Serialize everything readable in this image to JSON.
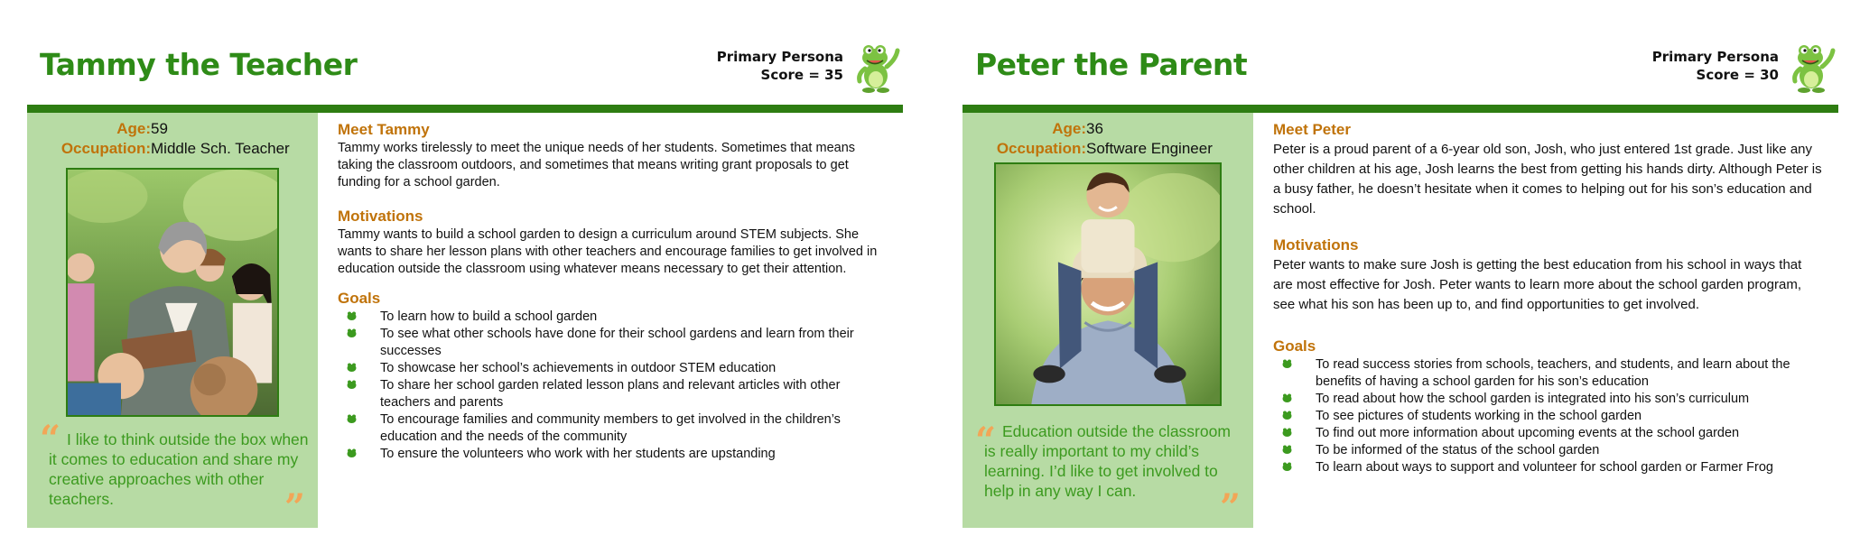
{
  "personas": [
    {
      "title": "Tammy the Teacher",
      "persona_type": "Primary Persona",
      "score": "Score = 35",
      "age_label": "Age:",
      "age": "59",
      "occupation_label": "Occupation:",
      "occupation": "Middle Sch. Teacher",
      "meet_heading": "Meet Tammy",
      "meet_text": "Tammy works tirelessly to meet the unique needs of her students. Sometimes that means taking the classroom outdoors, and sometimes that means writing grant proposals to get funding for a school garden.",
      "motivations_heading": "Motivations",
      "motivations_text": "Tammy wants to build a school garden to design a curriculum around STEM subjects. She wants to share her lesson plans with other teachers and encourage families to get involved in education outside the classroom using whatever means necessary to get their attention.",
      "goals_heading": "Goals",
      "goals": [
        "To learn how to build a school garden",
        "To see what other schools have done for their school gardens and learn from their successes",
        "To showcase her school’s achievements in outdoor STEM education",
        "To share her school garden related lesson plans and relevant articles with other teachers and parents",
        "To encourage families and community members to get involved in the children’s education and the needs of the community",
        "To ensure the volunteers who work with her students are upstanding"
      ],
      "quote": "I like to think outside the box when it comes to education and share my creative approaches with other teachers.",
      "photo_icon": "teacher-with-students-photo"
    },
    {
      "title": "Peter the Parent",
      "persona_type": "Primary Persona",
      "score": "Score = 30",
      "age_label": "Age:",
      "age": "36",
      "occupation_label": "Occupation:",
      "occupation": "Software Engineer",
      "meet_heading": "Meet Peter",
      "meet_text": "Peter is a proud parent of a 6-year old son, Josh, who just entered 1st grade. Just like any other children at his age, Josh learns the best from getting his hands dirty. Although Peter is a busy father, he doesn’t hesitate when it comes to helping out for his son’s education and school.",
      "motivations_heading": "Motivations",
      "motivations_text": "Peter wants to make sure Josh is getting the best education from his school in ways that are most effective for Josh. Peter wants to learn more about the school garden program, see what his son has been up to, and find opportunities to get involved.",
      "goals_heading": "Goals",
      "goals": [
        "To read success stories from schools, teachers, and students, and learn about the benefits of having a school garden for his son’s education",
        "To read about how the school garden is integrated into his son’s curriculum",
        "To see pictures of students working in the school garden",
        "To find out more information about upcoming events at the school garden",
        "To be informed of the status of the school garden",
        "To learn about ways to support and volunteer for school garden or Farmer Frog"
      ],
      "quote": "Education outside the classroom is really important to my child’s learning. I’d like to get involved to help in any way I can.",
      "photo_icon": "father-with-son-photo"
    }
  ],
  "colors": {
    "title_green": "#2e8b17",
    "rule_green": "#2e7d12",
    "sidebar_bg": "#b7dba4",
    "heading_orange": "#c0730a",
    "quote_green": "#3c9a1f",
    "quote_mark": "#f2a657"
  },
  "icons": {
    "frog": "frog-mascot-icon",
    "goal_bullet": "frog-bullet-icon"
  }
}
